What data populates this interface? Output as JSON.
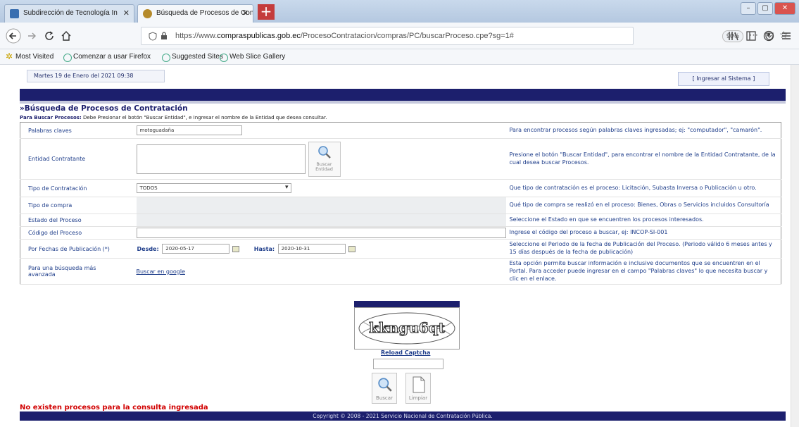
{
  "browser": {
    "tabs": [
      {
        "title": "Subdirección de Tecnología In",
        "active": false
      },
      {
        "title": "Búsqueda de Procesos de Cont",
        "active": true
      }
    ],
    "tab_close": "✕",
    "new_tab": "+",
    "window_controls": [
      "–",
      "▢",
      "✕"
    ],
    "url_prefix": "https://www.",
    "url_domain": "compraspublicas.gob.ec",
    "url_path": "/ProcesoContratacion/compras/PC/buscarProceso.cpe?sg=1#",
    "zoom": "90%",
    "nav_icons": [
      "back-icon",
      "forward-icon",
      "reload-icon",
      "home-icon"
    ],
    "bookmarks": [
      "Most Visited",
      "Comenzar a usar Firefox",
      "Suggested Sites",
      "Web Slice Gallery"
    ]
  },
  "page": {
    "date": "Martes 19 de Enero del 2021 09:38",
    "login": "[ Ingresar al Sistema ]",
    "section_title": "»Búsqueda de Procesos de Contratación",
    "instruction_bold": "Para Buscar Procesos:",
    "instruction_text": " Debe Presionar el botón \"Buscar Entidad\", e Ingresar el nombre de la Entidad que desea consultar.",
    "rows": {
      "palabras": {
        "label": "Palabras claves",
        "value": "motoguadaña",
        "help": "Para encontrar procesos según palabras claves ingresadas; ej: \"computador\", \"camarón\"."
      },
      "entidad": {
        "label": "Entidad Contratante",
        "button": "Buscar Entidad",
        "help": "Presione el botón \"Buscar Entidad\", para encontrar el nombre de la Entidad Contratante, de la cual desea buscar Procesos."
      },
      "tipo_contratacion": {
        "label": "Tipo de Contratación",
        "value": "TODOS",
        "help": "Que tipo de contratación es el proceso: Licitación, Subasta Inversa o Publicación u otro."
      },
      "tipo_compra": {
        "label": "Tipo de compra",
        "help": "Qué tipo de compra se realizó en el proceso: Bienes, Obras o Servicios incluidos Consultoría"
      },
      "estado": {
        "label": "Estado del Proceso",
        "help": "Seleccione el Estado en que se encuentren los procesos interesados."
      },
      "codigo": {
        "label": "Código del Proceso",
        "help": "Ingrese el código del proceso a buscar, ej: INCOP-SI-001"
      },
      "fechas": {
        "label": "Por Fechas de Publicación (*)",
        "desde_label": "Desde:",
        "desde": "2020-05-17",
        "hasta_label": "Hasta:",
        "hasta": "2020-10-31",
        "help": "Seleccione el Periodo de la fecha de Publicación del Proceso. (Periodo válido 6 meses antes y 15 días después de la fecha de publicación)"
      },
      "avanzada": {
        "label": "Para una búsqueda más avanzada",
        "link": "Buscar en google",
        "help": "Esta opción permite buscar información e inclusive documentos que se encuentren en el Portal. Para acceder puede ingresar en el campo \"Palabras claves\" lo que necesita buscar y clic en el enlace."
      }
    },
    "captcha_text": "kkngu6qt",
    "reload_captcha": "Reload Captcha",
    "buscar": "Buscar",
    "limpiar": "Limpiar",
    "error": "No existen procesos para la consulta ingresada",
    "footer": "Copyright © 2008 - 2021 Servicio Nacional de Contratación Pública."
  }
}
